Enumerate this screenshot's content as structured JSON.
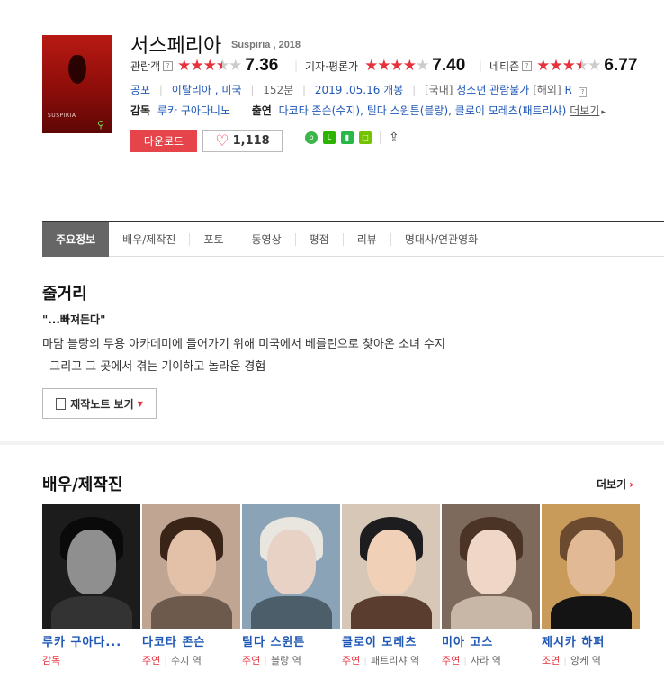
{
  "movie": {
    "title": "서스페리아",
    "subtitle": "Suspiria , 2018",
    "poster_title": "SUSPIRIA",
    "ratings": [
      {
        "label": "관람객",
        "score": "7.36",
        "stars": 3.5
      },
      {
        "label": "기자·평론가",
        "score": "7.40",
        "stars": 4
      },
      {
        "label": "네티즌",
        "score": "6.77",
        "stars": 3.5
      }
    ],
    "help_icon": "?",
    "genre": "공포",
    "country": "이탈리아 , 미국",
    "runtime": "152분",
    "release": "2019 .05.16 개봉",
    "rating_kr_label": "[국내]",
    "rating_kr": "청소년 관람불가",
    "rating_intl_label": "[해외]",
    "rating_intl": "R",
    "director_label": "감독",
    "director": "루카 구아다니노",
    "cast_label": "출연",
    "cast_list": "다코타 존슨(수지), 틸다 스윈튼(블랑), 클로이 모레츠(패트리샤)",
    "more_label": "더보기"
  },
  "actions": {
    "download": "다운로드",
    "likes": "1,118"
  },
  "tabs": [
    "주요정보",
    "배우/제작진",
    "포토",
    "동영상",
    "평점",
    "리뷰",
    "명대사/연관영화"
  ],
  "plot": {
    "title": "줄거리",
    "tagline": "\"...빠져든다\"",
    "text": "마담 블랑의 무용 아카데미에 들어가기 위해 미국에서 베를린으로 찾아온 소녀 수지\n  그리고 그 곳에서 겪는 기이하고 놀라운 경험",
    "note_button": "제작노트 보기"
  },
  "cast_section": {
    "title": "배우/제작진",
    "more": "더보기",
    "people": [
      {
        "name": "루카 구아다...",
        "role": "감독",
        "character": ""
      },
      {
        "name": "다코타 존슨",
        "role": "주연",
        "character": "수지 역"
      },
      {
        "name": "틸다 스윈튼",
        "role": "주연",
        "character": "블랑 역"
      },
      {
        "name": "클로이 모레츠",
        "role": "주연",
        "character": "패트리샤 역"
      },
      {
        "name": "미아 고스",
        "role": "주연",
        "character": "사라 역"
      },
      {
        "name": "제시카 하퍼",
        "role": "조연",
        "character": "앙케 역"
      }
    ]
  }
}
